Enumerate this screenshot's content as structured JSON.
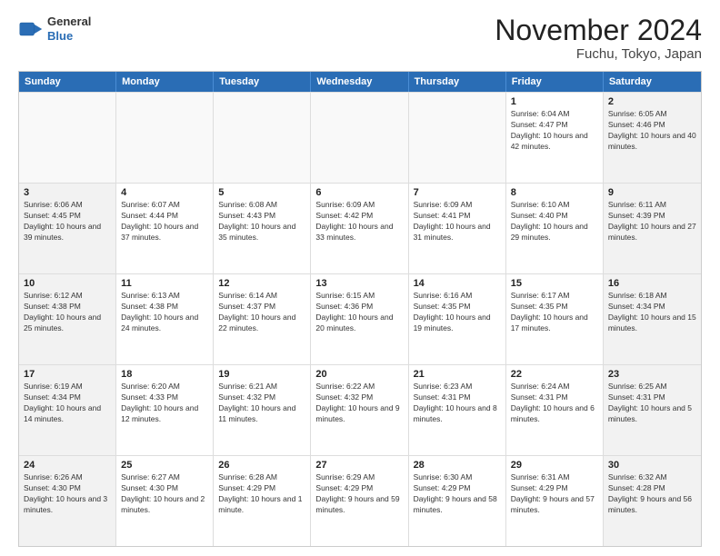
{
  "header": {
    "logo": {
      "general": "General",
      "blue": "Blue"
    },
    "title": "November 2024",
    "subtitle": "Fuchu, Tokyo, Japan"
  },
  "weekdays": [
    "Sunday",
    "Monday",
    "Tuesday",
    "Wednesday",
    "Thursday",
    "Friday",
    "Saturday"
  ],
  "rows": [
    [
      {
        "day": "",
        "empty": true
      },
      {
        "day": "",
        "empty": true
      },
      {
        "day": "",
        "empty": true
      },
      {
        "day": "",
        "empty": true
      },
      {
        "day": "",
        "empty": true
      },
      {
        "day": "1",
        "sunrise": "Sunrise: 6:04 AM",
        "sunset": "Sunset: 4:47 PM",
        "daylight": "Daylight: 10 hours and 42 minutes."
      },
      {
        "day": "2",
        "sunrise": "Sunrise: 6:05 AM",
        "sunset": "Sunset: 4:46 PM",
        "daylight": "Daylight: 10 hours and 40 minutes."
      }
    ],
    [
      {
        "day": "3",
        "sunrise": "Sunrise: 6:06 AM",
        "sunset": "Sunset: 4:45 PM",
        "daylight": "Daylight: 10 hours and 39 minutes."
      },
      {
        "day": "4",
        "sunrise": "Sunrise: 6:07 AM",
        "sunset": "Sunset: 4:44 PM",
        "daylight": "Daylight: 10 hours and 37 minutes."
      },
      {
        "day": "5",
        "sunrise": "Sunrise: 6:08 AM",
        "sunset": "Sunset: 4:43 PM",
        "daylight": "Daylight: 10 hours and 35 minutes."
      },
      {
        "day": "6",
        "sunrise": "Sunrise: 6:09 AM",
        "sunset": "Sunset: 4:42 PM",
        "daylight": "Daylight: 10 hours and 33 minutes."
      },
      {
        "day": "7",
        "sunrise": "Sunrise: 6:09 AM",
        "sunset": "Sunset: 4:41 PM",
        "daylight": "Daylight: 10 hours and 31 minutes."
      },
      {
        "day": "8",
        "sunrise": "Sunrise: 6:10 AM",
        "sunset": "Sunset: 4:40 PM",
        "daylight": "Daylight: 10 hours and 29 minutes."
      },
      {
        "day": "9",
        "sunrise": "Sunrise: 6:11 AM",
        "sunset": "Sunset: 4:39 PM",
        "daylight": "Daylight: 10 hours and 27 minutes."
      }
    ],
    [
      {
        "day": "10",
        "sunrise": "Sunrise: 6:12 AM",
        "sunset": "Sunset: 4:38 PM",
        "daylight": "Daylight: 10 hours and 25 minutes."
      },
      {
        "day": "11",
        "sunrise": "Sunrise: 6:13 AM",
        "sunset": "Sunset: 4:38 PM",
        "daylight": "Daylight: 10 hours and 24 minutes."
      },
      {
        "day": "12",
        "sunrise": "Sunrise: 6:14 AM",
        "sunset": "Sunset: 4:37 PM",
        "daylight": "Daylight: 10 hours and 22 minutes."
      },
      {
        "day": "13",
        "sunrise": "Sunrise: 6:15 AM",
        "sunset": "Sunset: 4:36 PM",
        "daylight": "Daylight: 10 hours and 20 minutes."
      },
      {
        "day": "14",
        "sunrise": "Sunrise: 6:16 AM",
        "sunset": "Sunset: 4:35 PM",
        "daylight": "Daylight: 10 hours and 19 minutes."
      },
      {
        "day": "15",
        "sunrise": "Sunrise: 6:17 AM",
        "sunset": "Sunset: 4:35 PM",
        "daylight": "Daylight: 10 hours and 17 minutes."
      },
      {
        "day": "16",
        "sunrise": "Sunrise: 6:18 AM",
        "sunset": "Sunset: 4:34 PM",
        "daylight": "Daylight: 10 hours and 15 minutes."
      }
    ],
    [
      {
        "day": "17",
        "sunrise": "Sunrise: 6:19 AM",
        "sunset": "Sunset: 4:34 PM",
        "daylight": "Daylight: 10 hours and 14 minutes."
      },
      {
        "day": "18",
        "sunrise": "Sunrise: 6:20 AM",
        "sunset": "Sunset: 4:33 PM",
        "daylight": "Daylight: 10 hours and 12 minutes."
      },
      {
        "day": "19",
        "sunrise": "Sunrise: 6:21 AM",
        "sunset": "Sunset: 4:32 PM",
        "daylight": "Daylight: 10 hours and 11 minutes."
      },
      {
        "day": "20",
        "sunrise": "Sunrise: 6:22 AM",
        "sunset": "Sunset: 4:32 PM",
        "daylight": "Daylight: 10 hours and 9 minutes."
      },
      {
        "day": "21",
        "sunrise": "Sunrise: 6:23 AM",
        "sunset": "Sunset: 4:31 PM",
        "daylight": "Daylight: 10 hours and 8 minutes."
      },
      {
        "day": "22",
        "sunrise": "Sunrise: 6:24 AM",
        "sunset": "Sunset: 4:31 PM",
        "daylight": "Daylight: 10 hours and 6 minutes."
      },
      {
        "day": "23",
        "sunrise": "Sunrise: 6:25 AM",
        "sunset": "Sunset: 4:31 PM",
        "daylight": "Daylight: 10 hours and 5 minutes."
      }
    ],
    [
      {
        "day": "24",
        "sunrise": "Sunrise: 6:26 AM",
        "sunset": "Sunset: 4:30 PM",
        "daylight": "Daylight: 10 hours and 3 minutes."
      },
      {
        "day": "25",
        "sunrise": "Sunrise: 6:27 AM",
        "sunset": "Sunset: 4:30 PM",
        "daylight": "Daylight: 10 hours and 2 minutes."
      },
      {
        "day": "26",
        "sunrise": "Sunrise: 6:28 AM",
        "sunset": "Sunset: 4:29 PM",
        "daylight": "Daylight: 10 hours and 1 minute."
      },
      {
        "day": "27",
        "sunrise": "Sunrise: 6:29 AM",
        "sunset": "Sunset: 4:29 PM",
        "daylight": "Daylight: 9 hours and 59 minutes."
      },
      {
        "day": "28",
        "sunrise": "Sunrise: 6:30 AM",
        "sunset": "Sunset: 4:29 PM",
        "daylight": "Daylight: 9 hours and 58 minutes."
      },
      {
        "day": "29",
        "sunrise": "Sunrise: 6:31 AM",
        "sunset": "Sunset: 4:29 PM",
        "daylight": "Daylight: 9 hours and 57 minutes."
      },
      {
        "day": "30",
        "sunrise": "Sunrise: 6:32 AM",
        "sunset": "Sunset: 4:28 PM",
        "daylight": "Daylight: 9 hours and 56 minutes."
      }
    ]
  ]
}
